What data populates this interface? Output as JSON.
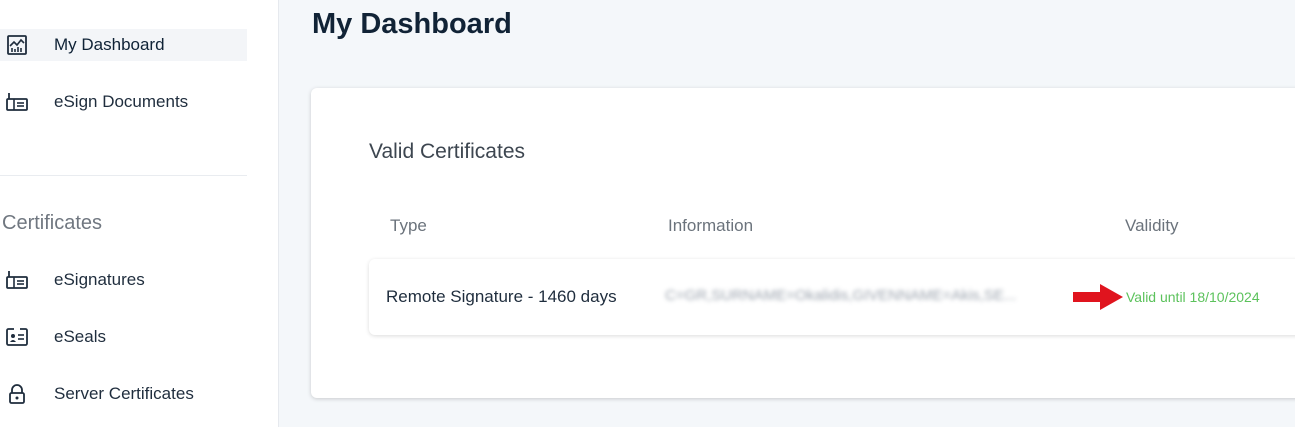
{
  "sidebar": {
    "items": [
      {
        "label": "My Dashboard",
        "icon": "chart-icon",
        "active": true
      },
      {
        "label": "eSign Documents",
        "icon": "sign-document-icon",
        "active": false
      }
    ],
    "section_title": "Certificates",
    "certificate_items": [
      {
        "label": "eSignatures",
        "icon": "sign-document-icon"
      },
      {
        "label": "eSeals",
        "icon": "id-card-icon"
      },
      {
        "label": "Server Certificates",
        "icon": "lock-icon"
      }
    ]
  },
  "main": {
    "title": "My Dashboard",
    "card": {
      "title": "Valid Certificates",
      "columns": [
        "Type",
        "Information",
        "Validity"
      ],
      "rows": [
        {
          "type": "Remote Signature - 1460 days",
          "information": "C=GR,SURNAME=Okalidis,GIVENNAME=Akis,SE...",
          "validity": "Valid until 18/10/2024"
        }
      ]
    }
  },
  "colors": {
    "valid_green": "#5cc25c",
    "annotation_arrow": "#e0141e",
    "title": "#112336"
  }
}
